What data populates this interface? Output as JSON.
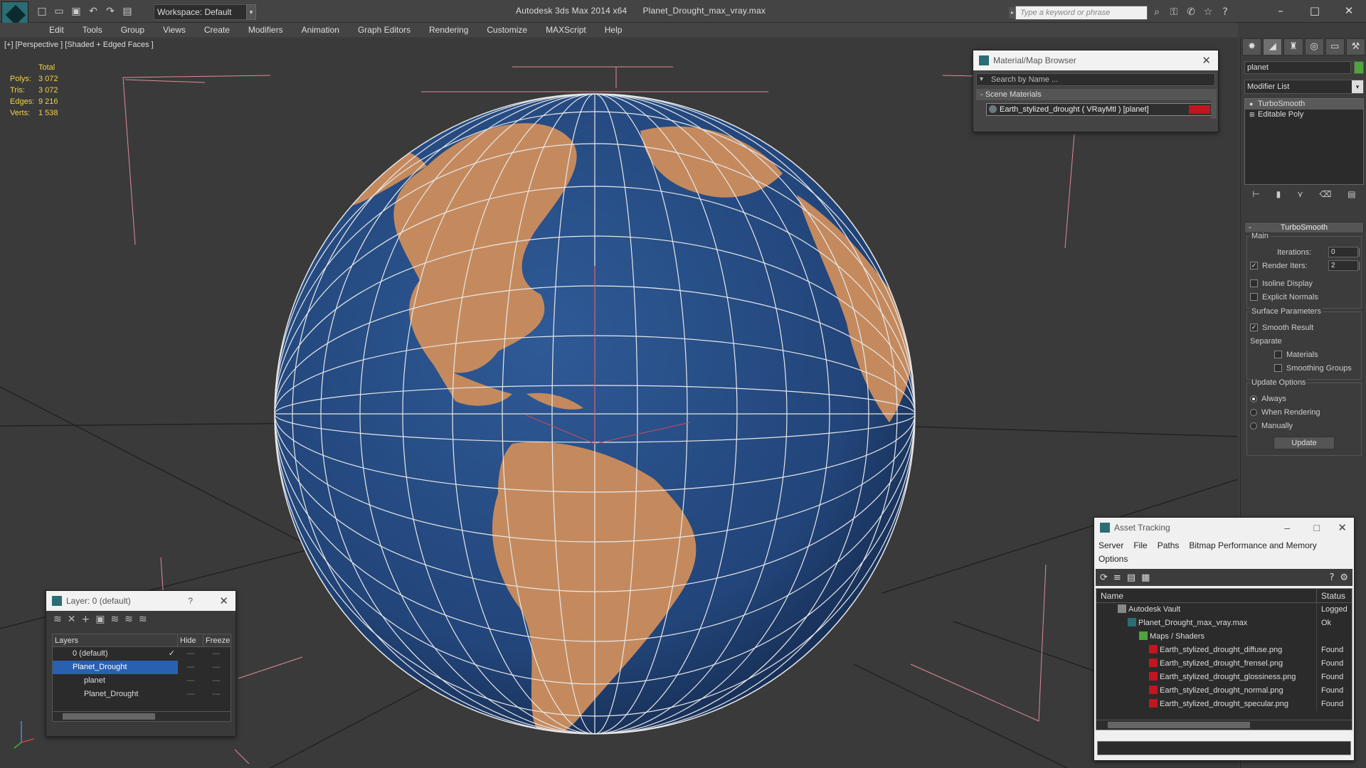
{
  "app": {
    "title": "Autodesk 3ds Max  2014 x64",
    "file": "Planet_Drought_max_vray.max",
    "workspace": "Workspace: Default",
    "search_placeholder": "Type a keyword or phrase"
  },
  "menu": [
    "Edit",
    "Tools",
    "Group",
    "Views",
    "Create",
    "Modifiers",
    "Animation",
    "Graph Editors",
    "Rendering",
    "Customize",
    "MAXScript",
    "Help"
  ],
  "viewport": {
    "label": "[+] [Perspective ] [Shaded + Edged Faces ]",
    "stats": {
      "total_label": "Total",
      "rows": [
        {
          "k": "Polys:",
          "v": "3 072"
        },
        {
          "k": "Tris:",
          "v": "3 072"
        },
        {
          "k": "Edges:",
          "v": "9 216"
        },
        {
          "k": "Verts:",
          "v": "1 538"
        }
      ]
    }
  },
  "command_panel": {
    "object_name": "planet",
    "object_color": "#4ea53a",
    "modifier_list": "Modifier List",
    "stack": [
      "TurboSmooth",
      "Editable Poly"
    ],
    "rollout_title": "TurboSmooth",
    "main_group": "Main",
    "iterations_label": "Iterations:",
    "iterations_value": "0",
    "render_iters_label": "Render Iters:",
    "render_iters_value": "2",
    "isoline_label": "Isoline Display",
    "explicit_label": "Explicit Normals",
    "surface_group": "Surface Parameters",
    "smooth_result": "Smooth Result",
    "separate_label": "Separate",
    "materials_label": "Materials",
    "smoothing_groups_label": "Smoothing Groups",
    "update_group": "Update Options",
    "always": "Always",
    "when_rendering": "When Rendering",
    "manually": "Manually",
    "update_button": "Update"
  },
  "material_browser": {
    "title": "Material/Map Browser",
    "search": "Search by Name ...",
    "section": "- Scene Materials",
    "item": "Earth_stylized_drought  ( VRayMtl )  [planet]",
    "swatch_color": "#c0161e"
  },
  "layer_window": {
    "title": "Layer: 0 (default)",
    "help": "?",
    "col_layers": "Layers",
    "col_hide": "Hide",
    "col_freeze": "Freeze",
    "rows": [
      "0 (default)",
      "Planet_Drought",
      "planet",
      "Planet_Drought"
    ]
  },
  "asset_tracking": {
    "title": "Asset Tracking",
    "menu": [
      "Server",
      "File",
      "Paths",
      "Bitmap Performance and Memory"
    ],
    "menu2": "Options",
    "col_name": "Name",
    "col_status": "Status",
    "rows": [
      {
        "name": "Autodesk Vault",
        "status": "Logged"
      },
      {
        "name": "Planet_Drought_max_vray.max",
        "status": "Ok"
      },
      {
        "name": "Maps / Shaders",
        "status": ""
      },
      {
        "name": "Earth_stylized_drought_diffuse.png",
        "status": "Found"
      },
      {
        "name": "Earth_stylized_drought_frensel.png",
        "status": "Found"
      },
      {
        "name": "Earth_stylized_drought_glossiness.png",
        "status": "Found"
      },
      {
        "name": "Earth_stylized_drought_normal.png",
        "status": "Found"
      },
      {
        "name": "Earth_stylized_drought_specular.png",
        "status": "Found"
      }
    ]
  },
  "colors": {
    "ocean": "#22457a",
    "land": "#c48a5e",
    "grid": "#e8e8e8",
    "stats": "#f0d24a",
    "selection": "#2a60b0"
  }
}
